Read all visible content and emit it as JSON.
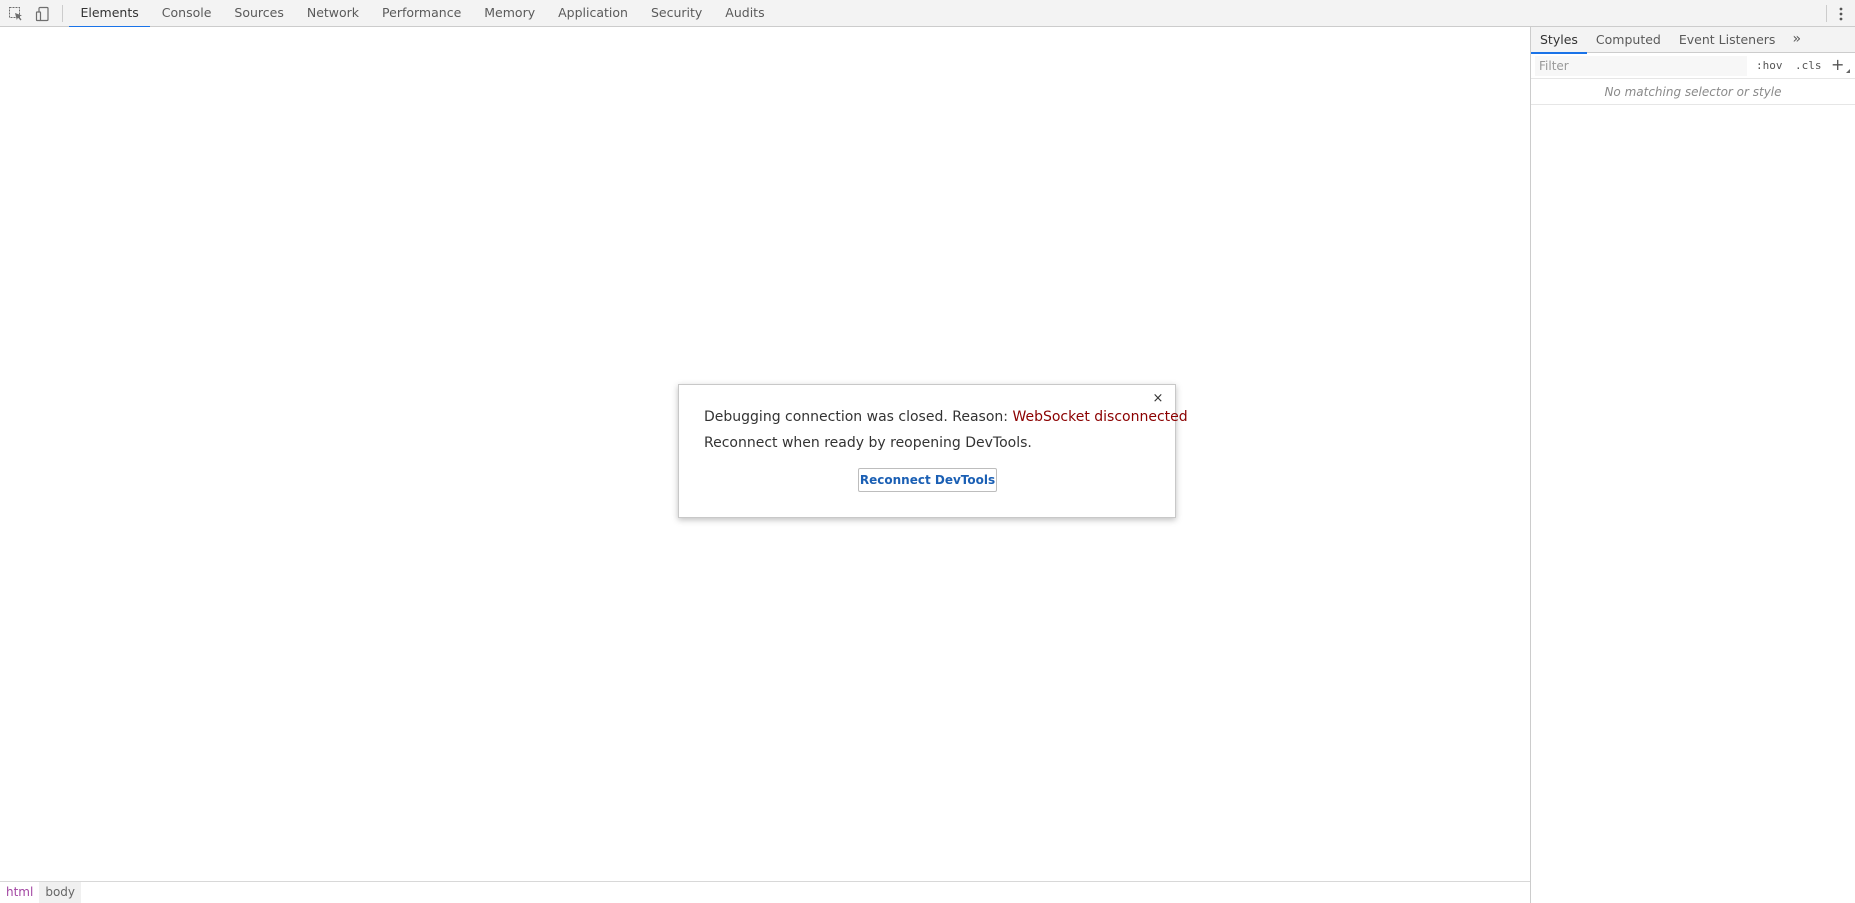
{
  "toolbar": {
    "inspect_icon": "inspect-element-icon",
    "device_icon": "device-toolbar-icon",
    "tabs": [
      {
        "label": "Elements",
        "active": true
      },
      {
        "label": "Console"
      },
      {
        "label": "Sources"
      },
      {
        "label": "Network"
      },
      {
        "label": "Performance"
      },
      {
        "label": "Memory"
      },
      {
        "label": "Application"
      },
      {
        "label": "Security"
      },
      {
        "label": "Audits"
      }
    ],
    "menu_icon": "kebab-menu-icon"
  },
  "sidebar": {
    "tabs": [
      {
        "label": "Styles",
        "active": true
      },
      {
        "label": "Computed"
      },
      {
        "label": "Event Listeners"
      }
    ],
    "more_label": "»",
    "filter_placeholder": "Filter",
    "hov_label": ":hov",
    "cls_label": ".cls",
    "add_label": "+",
    "empty_message": "No matching selector or style"
  },
  "breadcrumbs": [
    "html",
    "body"
  ],
  "dialog": {
    "close_label": "×",
    "message_prefix": "Debugging connection was closed. Reason: ",
    "reason": "WebSocket disconnected",
    "message_line2": "Reconnect when ready by reopening DevTools.",
    "button_label": "Reconnect DevTools"
  },
  "colors": {
    "accent": "#1a73e8",
    "reason": "#8b0000",
    "button_text": "#1a5fb4",
    "crumb_html": "#a346a3"
  }
}
